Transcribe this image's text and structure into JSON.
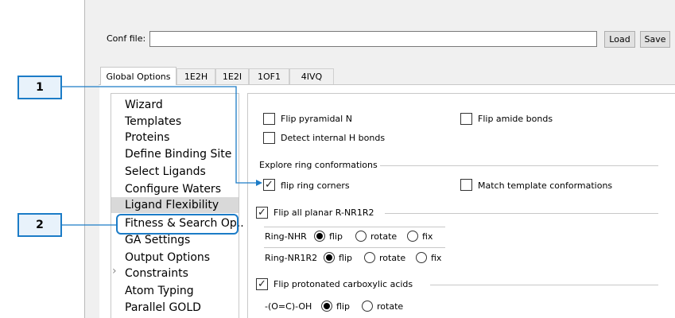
{
  "conf": {
    "label": "Conf file:",
    "value": "",
    "load_label": "Load",
    "save_label": "Save"
  },
  "tabs": [
    {
      "label": "Global Options",
      "active": true
    },
    {
      "label": "1E2H",
      "active": false
    },
    {
      "label": "1E2I",
      "active": false
    },
    {
      "label": "1OF1",
      "active": false
    },
    {
      "label": "4IVQ",
      "active": false
    }
  ],
  "nav": {
    "selected": "Ligand Flexibility",
    "items": [
      "Wizard",
      "Templates",
      "Proteins",
      "Define Binding Site",
      "Select Ligands",
      "Configure Waters",
      "Ligand Flexibility",
      "Fitness & Search Op..",
      "GA Settings",
      "Output Options",
      "Constraints",
      "Atom Typing",
      "Parallel GOLD"
    ]
  },
  "panel": {
    "flip_pyramidal_n": {
      "label": "Flip pyramidal N",
      "checked": false
    },
    "flip_amide_bonds": {
      "label": "Flip amide bonds",
      "checked": false
    },
    "detect_internal_h": {
      "label": "Detect internal H bonds",
      "checked": false
    },
    "ring_group_title": "Explore ring conformations",
    "flip_ring_corners": {
      "label": "flip ring corners",
      "checked": true
    },
    "match_template": {
      "label": "Match template conformations",
      "checked": false
    },
    "flip_planar": {
      "label": "Flip all planar R-NR1R2",
      "checked": true
    },
    "ring_nhr": {
      "label": "Ring-NHR",
      "opts": [
        "flip",
        "rotate",
        "fix"
      ],
      "selected": "flip"
    },
    "ring_nr1r2": {
      "label": "Ring-NR1R2",
      "opts": [
        "flip",
        "rotate",
        "fix"
      ],
      "selected": "flip"
    },
    "flip_carboxylic": {
      "label": "Flip protonated carboxylic acids",
      "checked": true
    },
    "carboxy": {
      "label": "-(O=C)-OH",
      "opts": [
        "flip",
        "rotate"
      ],
      "selected": "flip"
    }
  },
  "callouts": [
    "1",
    "2"
  ],
  "colors": {
    "callout_border": "#1c7cc7",
    "callout_fill": "#e8f2fb",
    "selection": "#d9d9d9"
  }
}
